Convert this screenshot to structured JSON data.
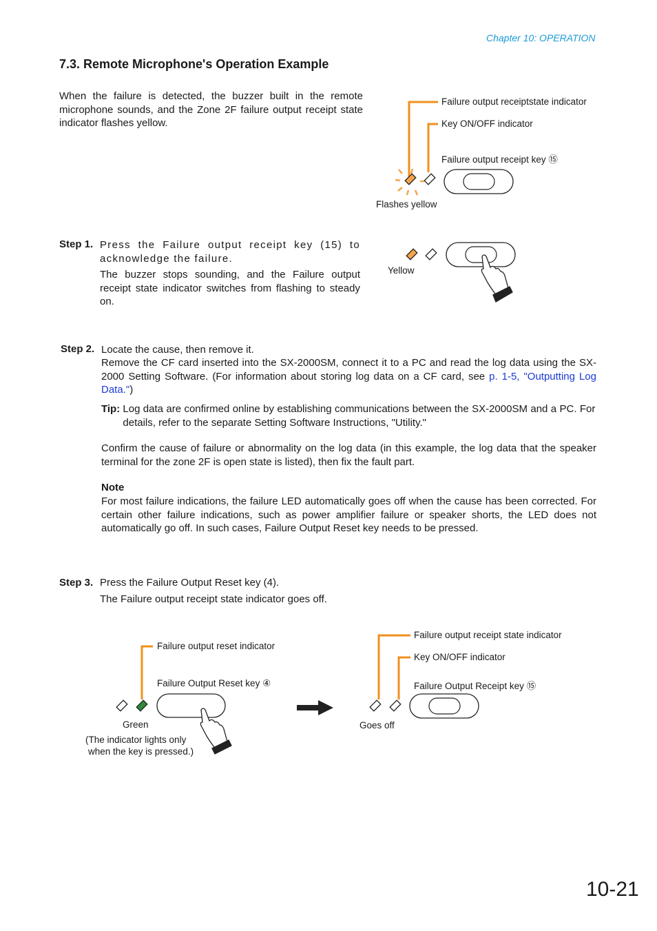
{
  "header": {
    "chapter": "Chapter 10: OPERATION"
  },
  "section": {
    "title": "7.3. Remote Microphone's Operation Example"
  },
  "intro": {
    "text": "When the failure is detected, the buzzer built in the remote microphone sounds, and the Zone 2F failure output receipt state indicator flashes yellow."
  },
  "figure1": {
    "labels": {
      "state_indicator": "Failure output receiptstate indicator",
      "key_onoff": "Key ON/OFF indicator",
      "receipt_key": "Failure output receipt key ⑮",
      "status": "Flashes yellow"
    }
  },
  "step1": {
    "label": "Step 1.",
    "text1": "Press the Failure output receipt key (15) to acknowledge the failure.",
    "text2": "The buzzer stops sounding, and the Failure output receipt state indicator switches from flashing to steady on.",
    "figure_status": "Yellow"
  },
  "step2": {
    "label": "Step 2.",
    "text0": "Locate the cause, then remove it.",
    "text1": "Remove the CF card inserted into the SX-2000SM, connect it to a PC and read the log data using the SX-2000 Setting Software. (For information about storing log data on a CF card, see ",
    "link": "p. 1-5, \"Outputting Log Data.\"",
    "text1_end": ")",
    "tip_label": "Tip:",
    "tip_text": "Log data are confirmed online by establishing communications between the SX-2000SM and a PC. For details, refer to the separate Setting Software Instructions, \"Utility.\"",
    "confirm": "Confirm the cause of failure or abnormality on the log data (in this example, the log data that the speaker terminal for the zone 2F is open state is listed), then fix the fault part.",
    "note_head": "Note",
    "note_body": "For most failure indications, the failure LED automatically goes off when the cause has been corrected. For certain other failure indications, such as power amplifier failure or speaker shorts, the LED does not automatically go off. In such cases, Failure Output Reset key needs to be pressed."
  },
  "step3": {
    "label": "Step 3.",
    "text0": "Press the Failure Output Reset key (4).",
    "text1": "The Failure output receipt state indicator goes off.",
    "left_figure": {
      "reset_indicator": "Failure output reset indicator",
      "reset_key": "Failure Output Reset key ④",
      "status": "Green",
      "note_line1": "(The indicator lights only",
      "note_line2": "when the key is pressed.)"
    },
    "right_figure": {
      "state_indicator": "Failure output receipt state indicator",
      "key_onoff": "Key ON/OFF indicator",
      "receipt_key": "Failure Output Receipt key ⑮",
      "status": "Goes off"
    }
  },
  "colors": {
    "leader": "#f0901e",
    "yellow_led": "#f5a34a",
    "green_led": "#2e8b3a",
    "chapter": "#1a9ad6",
    "link": "#1a3ad6"
  },
  "footer": {
    "page_number": "10-21"
  }
}
